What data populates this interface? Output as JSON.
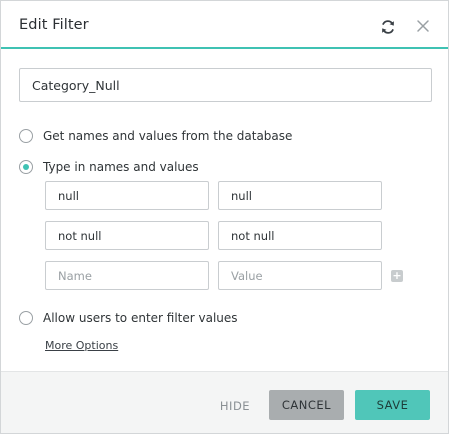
{
  "dialog": {
    "title": "Edit Filter"
  },
  "filter": {
    "name_value": "Category_Null"
  },
  "options": {
    "from_database_label": "Get names and values from the database",
    "type_in_label": "Type in names and values",
    "allow_users_label": "Allow users to enter filter values",
    "selected": "type_in"
  },
  "pairs": [
    {
      "name": "null",
      "value": "null"
    },
    {
      "name": "not null",
      "value": "not null"
    }
  ],
  "new_pair": {
    "name_placeholder": "Name",
    "value_placeholder": "Value"
  },
  "add_label": "+",
  "more_options_label": "More Options",
  "footer": {
    "hide_label": "HIDE",
    "cancel_label": "CANCEL",
    "save_label": "SAVE"
  },
  "colors": {
    "accent": "#3fc2b3",
    "save_bg": "#50c6b9",
    "cancel_bg": "#a9adaf",
    "footer_bg": "#f4f5f5"
  },
  "icons": {
    "refresh": "refresh-icon",
    "close": "close-icon",
    "add": "plus-icon"
  }
}
